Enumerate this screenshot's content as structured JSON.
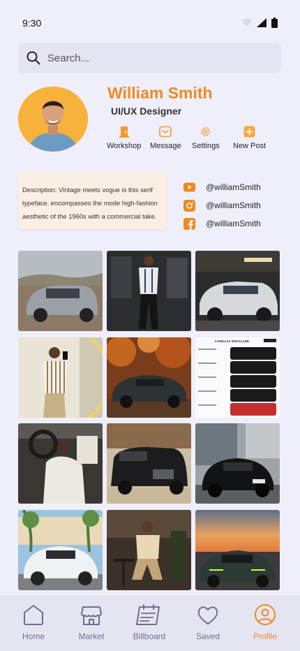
{
  "status": {
    "time": "9:30"
  },
  "search": {
    "placeholder": "Search..."
  },
  "profile": {
    "name": "William Smith",
    "role": "UI/UX Designer",
    "actions": [
      "Workshop",
      "Message",
      "Settings",
      "New Post"
    ],
    "description": "Description: Vintage meets vogue is this serif typeface. encompasses the mode high-fashion aesthetic of the 1960s with a commercial take.",
    "socials": [
      {
        "icon": "youtube-icon",
        "handle": "@williamSmith"
      },
      {
        "icon": "instagram-icon",
        "handle": "@williamSmith"
      },
      {
        "icon": "facebook-icon",
        "handle": "@williamSmith"
      }
    ]
  },
  "gallery": {
    "posts": [
      "silver suv on dirt road",
      "man in white shirt in parking garage",
      "white range rover in showroom",
      "man in striped shirt taking mirror selfie",
      "black sports car in autumn forest",
      "cadillac escalade comparison sheet",
      "man sitting in car interior",
      "black cadillac escalade",
      "black mercedes suv on street",
      "white mercedes suv near palms",
      "man sitting in cafe",
      "dark green sports car at sunset"
    ],
    "poster_title": "CADILLAC ESCALADE"
  },
  "tabs": [
    {
      "label": "Home",
      "icon": "home-icon",
      "active": false
    },
    {
      "label": "Market",
      "icon": "store-icon",
      "active": false
    },
    {
      "label": "Billboard",
      "icon": "billboard-icon",
      "active": false
    },
    {
      "label": "Saved",
      "icon": "heart-icon",
      "active": false
    },
    {
      "label": "Profile",
      "icon": "profile-icon",
      "active": true
    }
  ],
  "colors": {
    "accent": "#ef8a23",
    "background": "#eeeffb",
    "inactive": "#6b6f8e",
    "avatar_bg": "#f6b23a"
  }
}
